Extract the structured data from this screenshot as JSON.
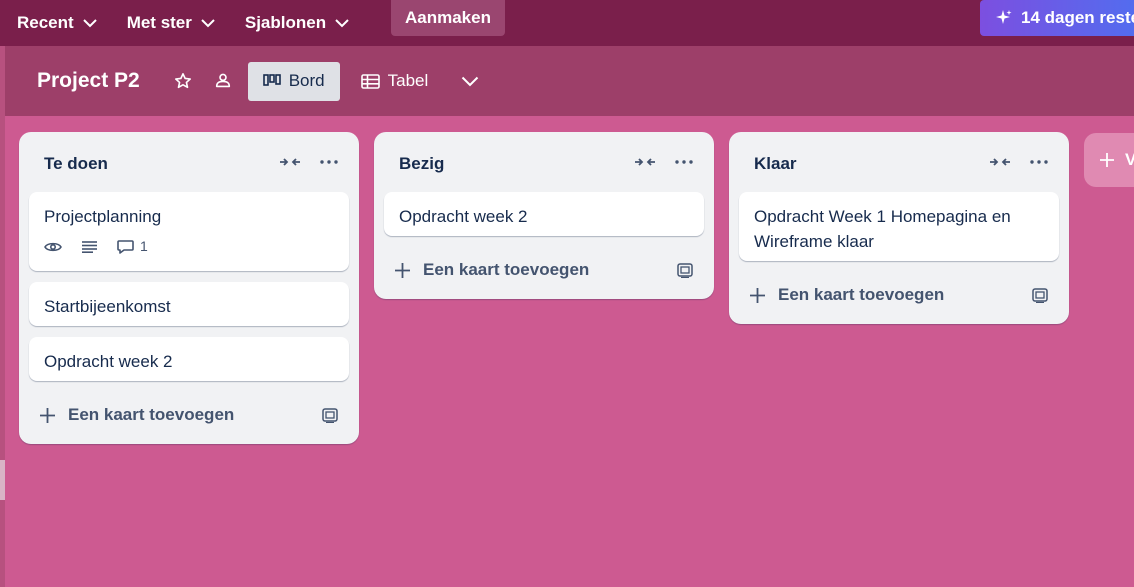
{
  "topnav": {
    "items": [
      {
        "label": "Recent"
      },
      {
        "label": "Met ster"
      },
      {
        "label": "Sjablonen"
      }
    ],
    "create_label": "Aanmaken",
    "trial_label": "14 dagen reste"
  },
  "board": {
    "title": "Project P2",
    "views": [
      {
        "label": "Bord",
        "active": true
      },
      {
        "label": "Tabel",
        "active": false
      }
    ]
  },
  "lists": [
    {
      "title": "Te doen",
      "cards": [
        {
          "title": "Projectplanning",
          "comment_count": "1"
        },
        {
          "title": "Startbijeenkomst"
        },
        {
          "title": "Opdracht week 2"
        }
      ],
      "add_label": "Een kaart toevoegen"
    },
    {
      "title": "Bezig",
      "cards": [
        {
          "title": "Opdracht week 2"
        }
      ],
      "add_label": "Een kaart toevoegen"
    },
    {
      "title": "Klaar",
      "cards": [
        {
          "title": "Opdracht Week 1 Homepagina en Wireframe klaar"
        }
      ],
      "add_label": "Een kaart toevoegen"
    }
  ],
  "add_list_label": "V",
  "colors": {
    "nav_bg": "#7a1f4b",
    "board_bg": "#cd5a91",
    "header_bg": "#9d3f69",
    "list_bg": "#f1f2f4"
  }
}
